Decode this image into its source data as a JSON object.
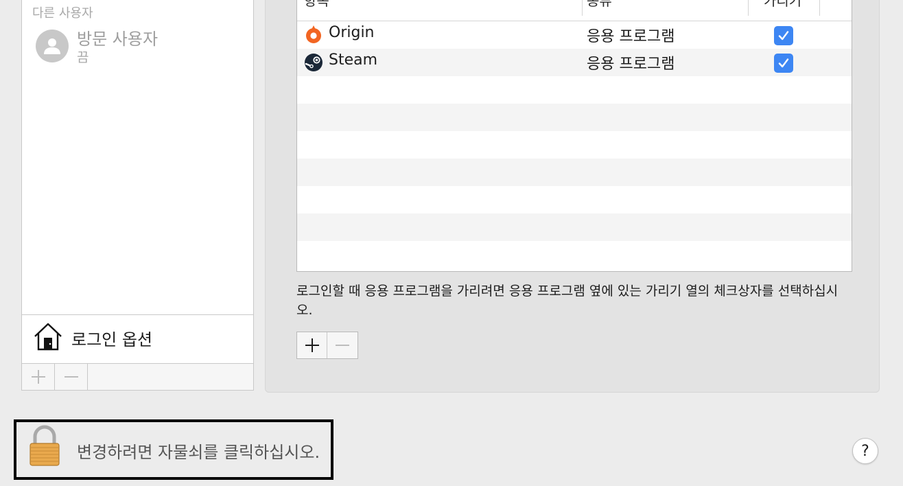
{
  "users_list": {
    "section_label": "다른 사용자",
    "guest": {
      "name": "방문 사용자",
      "status": "끔"
    },
    "login_options_label": "로그인 옵션"
  },
  "login_items": {
    "columns": [
      "항목",
      "종류",
      "가리기"
    ],
    "rows": [
      {
        "name": "Origin",
        "kind": "응용 프로그램",
        "hide": true,
        "icon": "origin-icon"
      },
      {
        "name": "Steam",
        "kind": "응용 프로그램",
        "hide": true,
        "icon": "steam-icon"
      }
    ],
    "hint": "로그인할 때 응용 프로그램을 가리려면 응용 프로그램 옆에 있는 가리기 열의 체크상자를 선택하십시오."
  },
  "lock": {
    "message": "변경하려면 자물쇠를 클릭하십시오."
  },
  "help": {
    "label": "?"
  },
  "colors": {
    "checkbox": "#3d86f3",
    "origin": "#f26522",
    "steam": "#1b2838"
  }
}
